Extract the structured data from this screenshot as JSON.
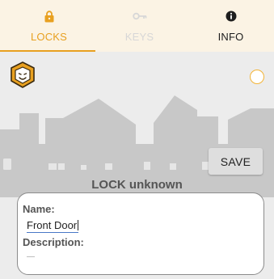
{
  "tabs": [
    {
      "label": "LOCKS",
      "icon": "padlock-icon",
      "color": "#e8a020",
      "active": true
    },
    {
      "label": "KEYS",
      "icon": "key-icon",
      "color": "#d7d7d7",
      "active": false
    },
    {
      "label": "INFO",
      "icon": "info-icon",
      "color": "#1e1e1e",
      "active": false
    }
  ],
  "colors": {
    "accent": "#e8a020",
    "tabbar_bg": "#fbf3e4",
    "skyline": "#c8c8c8",
    "status_ring": "#f3b437"
  },
  "save_label": "SAVE",
  "lock_title": "LOCK unknown",
  "form": {
    "name_label": "Name:",
    "name_value": "Front Door",
    "description_label": "Description:",
    "description_value": ""
  }
}
